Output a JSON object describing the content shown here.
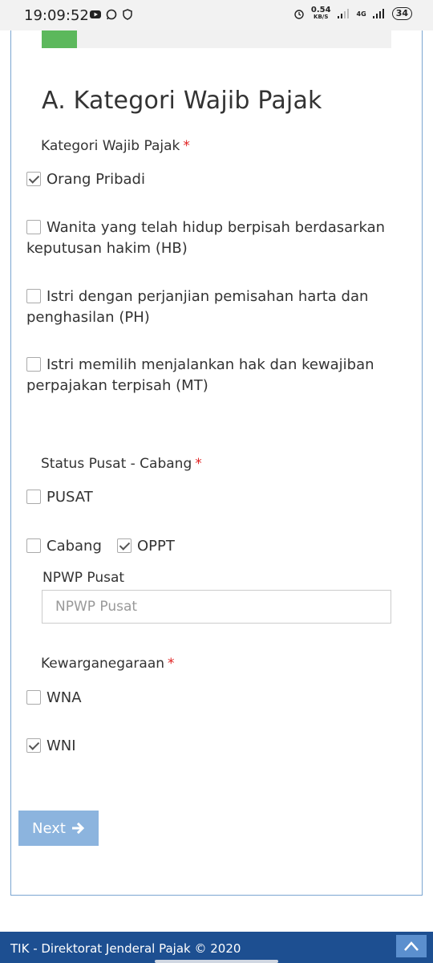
{
  "status_bar": {
    "time": "19:09:52",
    "speed_value": "0.54",
    "speed_unit": "KB/S",
    "network": "4G",
    "battery": "34"
  },
  "progress": {
    "fraction": 0.1
  },
  "section": {
    "title": "A. Kategori Wajib Pajak"
  },
  "kategori": {
    "label": "Kategori Wajib Pajak",
    "required_mark": "*",
    "options": [
      {
        "label": "Orang Pribadi",
        "checked": true
      },
      {
        "label": "Wanita yang telah hidup berpisah berdasarkan keputusan hakim (HB)",
        "checked": false
      },
      {
        "label": "Istri dengan perjanjian pemisahan harta dan penghasilan (PH)",
        "checked": false
      },
      {
        "label": "Istri memilih menjalankan hak dan kewajiban perpajakan terpisah (MT)",
        "checked": false
      }
    ]
  },
  "status_pusat": {
    "label": "Status Pusat - Cabang",
    "required_mark": "*",
    "options": [
      {
        "label": "PUSAT",
        "checked": false
      },
      {
        "label": "Cabang",
        "checked": false
      },
      {
        "label": "OPPT",
        "checked": true
      }
    ]
  },
  "npwp_pusat": {
    "label": "NPWP Pusat",
    "placeholder": "NPWP Pusat",
    "value": ""
  },
  "kewarganegaraan": {
    "label": "Kewarganegaraan",
    "required_mark": "*",
    "options": [
      {
        "label": "WNA",
        "checked": false
      },
      {
        "label": "WNI",
        "checked": true
      }
    ]
  },
  "next_button": {
    "label": "Next",
    "icon": "arrow-right-icon"
  },
  "footer": {
    "text": "TIK - Direktorat Jenderal Pajak © 2020",
    "scroll_icon": "chevron-up-icon"
  },
  "colors": {
    "footer_bg": "#1d4f91",
    "button_bg": "#8cb4de",
    "progress_fill": "#5cb85c",
    "required": "#e02020",
    "card_border": "#7ba6d1"
  }
}
